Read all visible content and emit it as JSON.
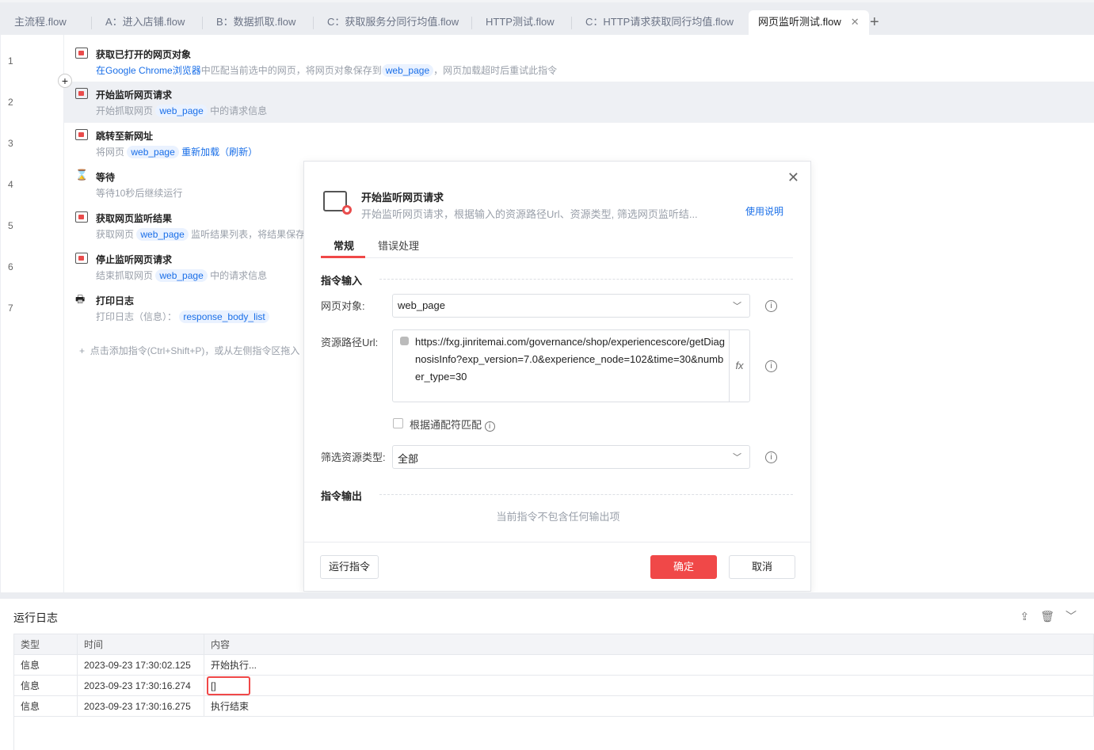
{
  "tabs": [
    {
      "label": "主流程.flow"
    },
    {
      "label": "A：进入店铺.flow"
    },
    {
      "label": "B：数据抓取.flow"
    },
    {
      "label": "C：获取服务分同行均值.flow"
    },
    {
      "label": "HTTP测试.flow"
    },
    {
      "label": "C：HTTP请求获取同行均值.flow"
    },
    {
      "label": "网页监听测试.flow",
      "active": true
    }
  ],
  "steps": [
    {
      "num": "1",
      "title": "获取已打开的网页对象",
      "d1": "在Google Chrome浏览器",
      "d2": "中匹配当前选中的网页，将网页对象保存到",
      "var": "web_page",
      "d3": "，网页加载超时后重试此指令"
    },
    {
      "num": "2",
      "title": "开始监听网页请求",
      "d1": "开始抓取网页",
      "var": "web_page",
      "d3": "中的请求信息"
    },
    {
      "num": "3",
      "title": "跳转至新网址",
      "d1": "将网页",
      "var": "web_page",
      "d3": "重新加载（刷新）"
    },
    {
      "num": "4",
      "title": "等待",
      "d1": "等待10秒后继续运行"
    },
    {
      "num": "5",
      "title": "获取网页监听结果",
      "d1": "获取网页",
      "var": "web_page",
      "d3": "监听结果列表，将结果保存"
    },
    {
      "num": "6",
      "title": "停止监听网页请求",
      "d1": "结束抓取网页",
      "var": "web_page",
      "d3": "中的请求信息"
    },
    {
      "num": "7",
      "title": "打印日志",
      "d1": "打印日志（信息）：",
      "var": "response_body_list"
    }
  ],
  "add_hint": "点击添加指令(Ctrl+Shift+P)，或从左侧指令区拖入",
  "dialog": {
    "title": "开始监听网页请求",
    "subtitle": "开始监听网页请求，根据输入的资源路径Url、资源类型, 筛选网页监听结...",
    "help": "使用说明",
    "tab_general": "常规",
    "tab_error": "错误处理",
    "input_section": "指令输入",
    "web_page_label": "网页对象:",
    "web_page_value": "web_page",
    "url_label": "资源路径Url:",
    "url_value": "https://fxg.jinritemai.com/governance/shop/experiencescore/getDiagnosisInfo?exp_version=7.0&experience_node=102&time=30&number_type=30",
    "fx": "fx",
    "wildcard_label": "根据通配符匹配",
    "wildcard_checked": false,
    "type_label": "筛选资源类型:",
    "type_value": "全部",
    "output_section": "指令输出",
    "no_output": "当前指令不包含任何输出项",
    "run": "运行指令",
    "ok": "确定",
    "cancel": "取消"
  },
  "log": {
    "title": "运行日志",
    "columns": [
      "类型",
      "时间",
      "内容"
    ],
    "rows": [
      [
        "信息",
        "2023-09-23 17:30:02.125",
        "开始执行..."
      ],
      [
        "信息",
        "2023-09-23 17:30:16.274",
        "[]"
      ],
      [
        "信息",
        "2023-09-23 17:30:16.275",
        "执行结束"
      ]
    ]
  },
  "colors": {
    "accent": "#f04848",
    "link": "#1a6fe8"
  }
}
